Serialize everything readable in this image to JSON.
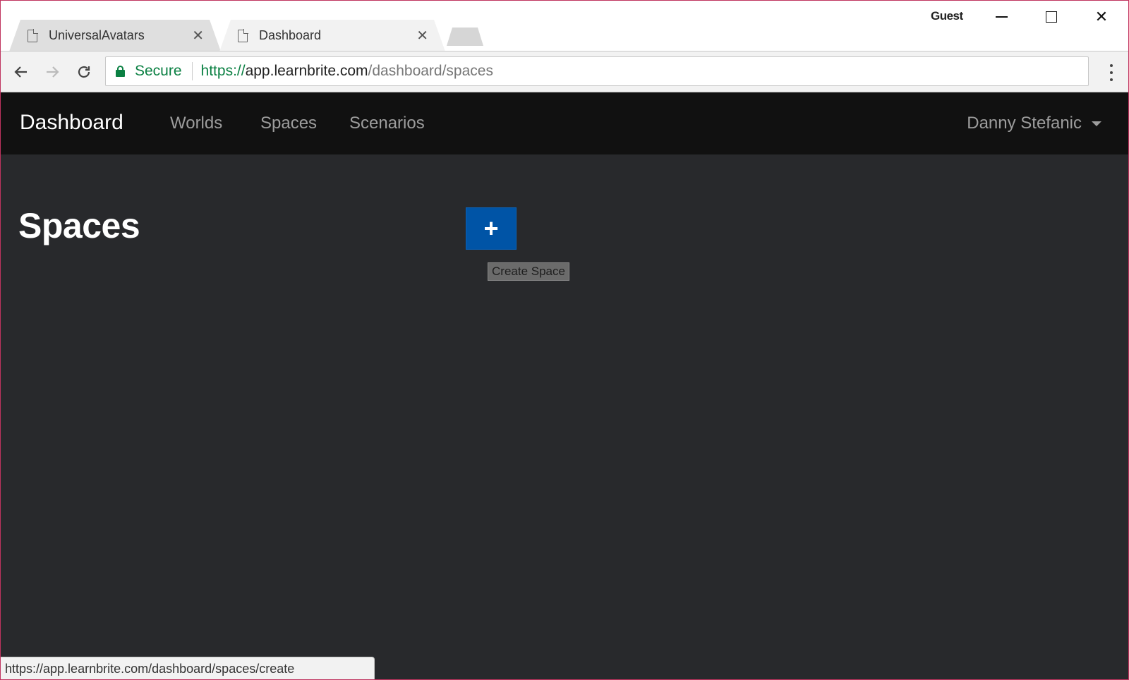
{
  "browser": {
    "tabs": [
      {
        "title": "UniversalAvatars",
        "close_icon": "close-icon",
        "icon": "page-icon"
      },
      {
        "title": "Dashboard",
        "close_icon": "close-icon",
        "icon": "page-icon"
      }
    ],
    "profile_label": "Guest",
    "window_controls": [
      "minimize",
      "maximize",
      "close"
    ],
    "omnibox": {
      "security_label": "Secure",
      "url_scheme": "https://",
      "url_host": "app.learnbrite.com",
      "url_path": "/dashboard/spaces"
    },
    "status_url": "https://app.learnbrite.com/dashboard/spaces/create"
  },
  "app": {
    "brand": "Dashboard",
    "nav": [
      {
        "label": "Worlds"
      },
      {
        "label": "Spaces"
      },
      {
        "label": "Scenarios"
      }
    ],
    "user_name": "Danny Stefanic"
  },
  "main": {
    "title": "Spaces",
    "create_button_symbol": "+",
    "create_tooltip": "Create Space"
  },
  "colors": {
    "window_border": "#c0335f",
    "navbar_bg": "#111111",
    "page_bg": "#28292c",
    "create_button_bg": "#0054a6",
    "secure_green": "#0b8043"
  }
}
